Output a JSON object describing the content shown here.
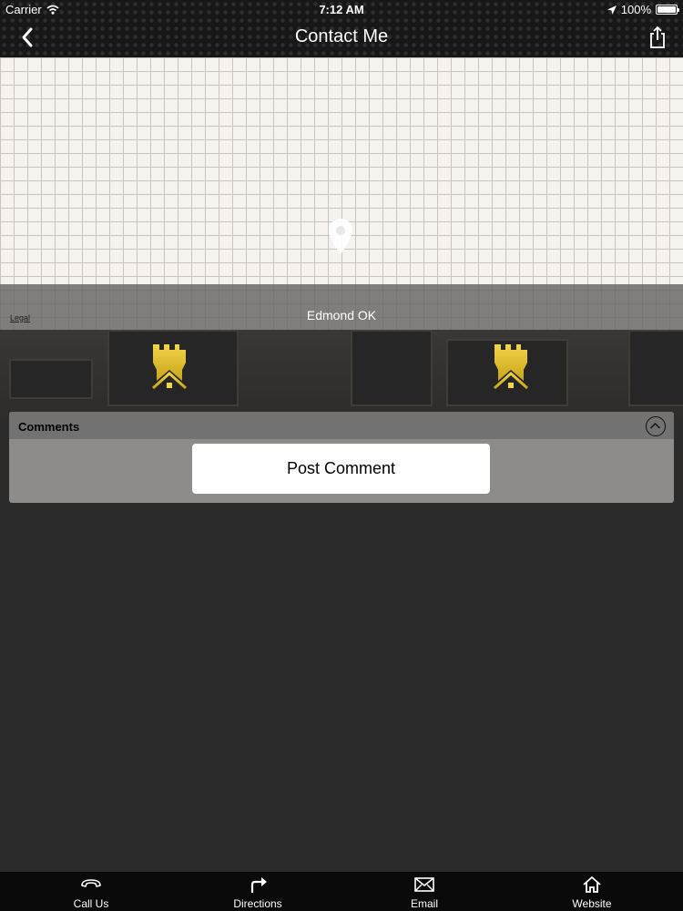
{
  "status_bar": {
    "carrier": "Carrier",
    "time": "7:12 AM",
    "battery": "100%"
  },
  "nav": {
    "title": "Contact Me"
  },
  "map": {
    "legal": "Legal",
    "address": "Edmond OK"
  },
  "comments": {
    "title": "Comments",
    "post_label": "Post Comment"
  },
  "tabbar": [
    {
      "label": "Call Us",
      "icon": "phone-icon"
    },
    {
      "label": "Directions",
      "icon": "directions-icon"
    },
    {
      "label": "Email",
      "icon": "envelope-icon"
    },
    {
      "label": "Website",
      "icon": "home-icon"
    }
  ],
  "colors": {
    "accent_gold": "#e6c229",
    "panel": "#8d8c8b",
    "background": "#2b2b2c"
  }
}
